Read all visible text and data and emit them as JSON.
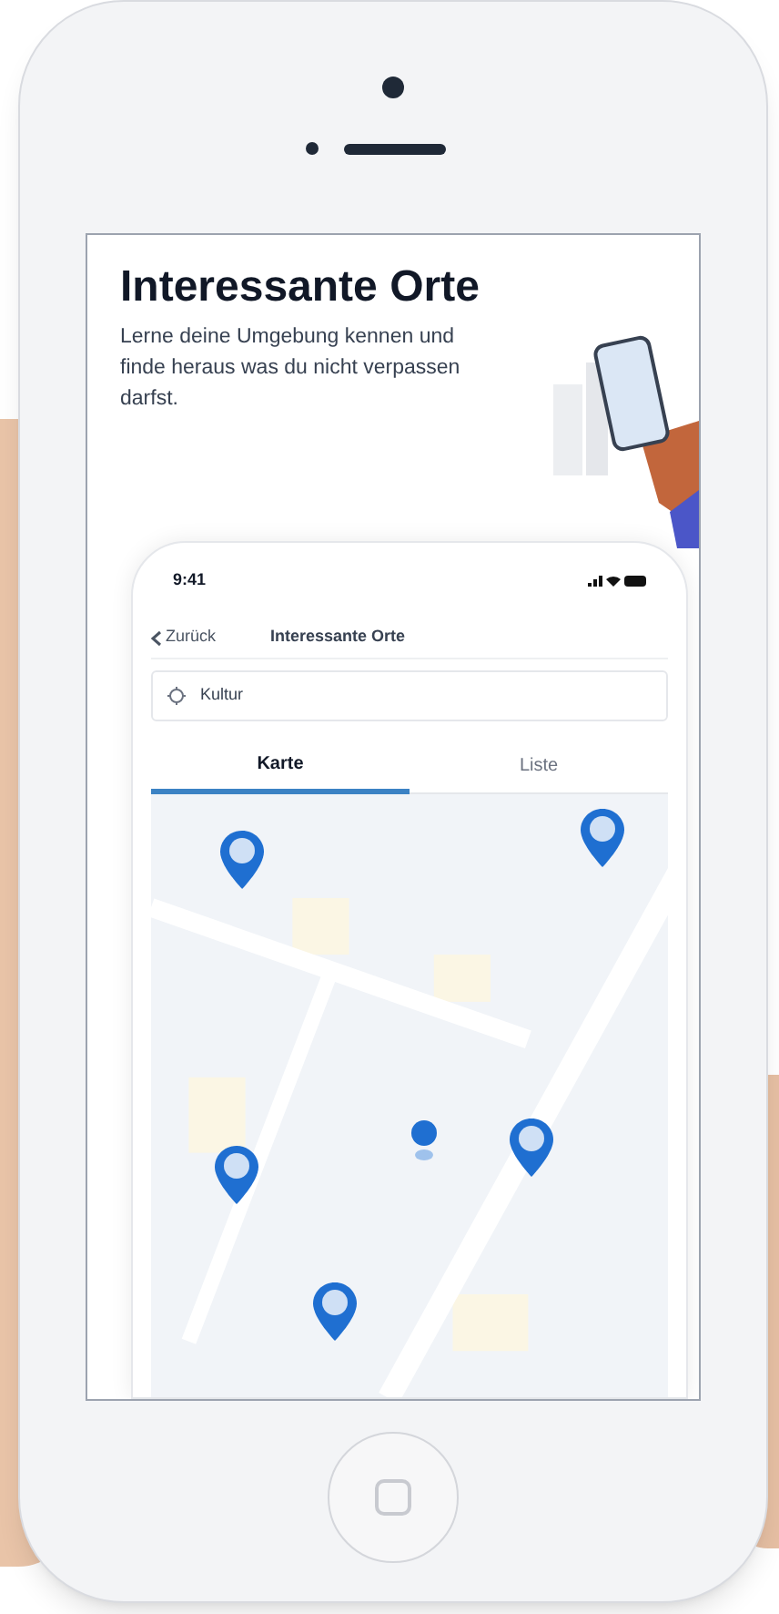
{
  "screen": {
    "title": "Interessante Orte",
    "subtitle": "Lerne deine Umgebung kennen und finde heraus was du nicht verpassen darfst.",
    "app": {
      "status_time": "9:41",
      "back_label": "Zurück",
      "nav_title": "Interessante Orte",
      "search": {
        "value": "Kultur"
      },
      "tabs": [
        {
          "label": "Karte",
          "selected": true
        },
        {
          "label": "Liste",
          "selected": false
        }
      ]
    }
  }
}
